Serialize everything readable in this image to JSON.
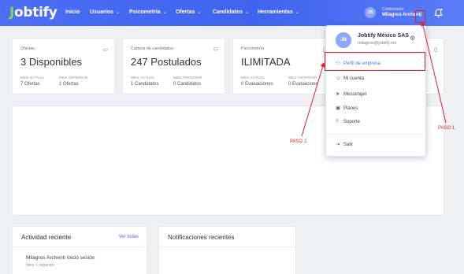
{
  "brand": {
    "logo_text": "Jobtify"
  },
  "nav": {
    "items": [
      {
        "label": "Inicio",
        "caret": false
      },
      {
        "label": "Usuarios",
        "caret": true
      },
      {
        "label": "Psicometría",
        "caret": true
      },
      {
        "label": "Ofertas",
        "caret": true
      },
      {
        "label": "Candidatos",
        "caret": true
      },
      {
        "label": "Herramientas",
        "caret": true
      }
    ]
  },
  "user": {
    "initials": "JB",
    "role": "Colaborador",
    "name": "Milagros Archenti",
    "toggle_glyph": "⌄"
  },
  "cards": [
    {
      "title": "Ofertas",
      "icon": "briefcase-icon",
      "value": "3 Disponibles",
      "current_label": "MES ACTUAL",
      "current_value": "7 Ofertas",
      "previous_label": "MES ANTERIOR",
      "previous_value": "1 Ofertas"
    },
    {
      "title": "Cartera de candidatos",
      "icon": "users-icon",
      "value": "247 Postulados",
      "current_label": "MES ACTUAL",
      "current_value": "1 Candidatos",
      "previous_label": "MES ANTERIOR",
      "previous_value": "0 Candidatos"
    },
    {
      "title": "Psicometría",
      "icon": "document-icon",
      "value": "ILIMITADA",
      "current_label": "MES ACTUAL",
      "current_value": "0 Evaluaciones",
      "previous_label": "MES ANTERIOR",
      "previous_value": "0 Evaluacione"
    }
  ],
  "activity": {
    "title": "Actividad reciente",
    "link": "Ver todas",
    "entry_text": "Milagros Archenti Inició sesión",
    "entry_time": "hace 1 segundo"
  },
  "notifications": {
    "title": "Notificaciones recientes"
  },
  "dropdown": {
    "avatar": "JB",
    "company": "Jobtify México SAS",
    "email": "milagros@jobtify.mx",
    "items": [
      {
        "label": "Perfil de empresa",
        "icon": "company-profile-icon",
        "glyph": "⚇"
      },
      {
        "label": "Mi cuenta",
        "icon": "user-icon",
        "glyph": "☺"
      },
      {
        "label": "Messenger",
        "icon": "send-icon",
        "glyph": "➤"
      },
      {
        "label": "Planes",
        "icon": "box-icon",
        "glyph": "▣"
      },
      {
        "label": "Soporte",
        "icon": "help-icon",
        "glyph": "?"
      },
      {
        "label": "Salir",
        "icon": "logout-icon",
        "glyph": "⇥"
      }
    ]
  },
  "annotations": {
    "step1": "PASO 1",
    "step2": "PASO 2"
  },
  "colors": {
    "accent": "#4b6ef5",
    "annotation": "#e0202a",
    "brand_green": "#7ddc4c"
  }
}
